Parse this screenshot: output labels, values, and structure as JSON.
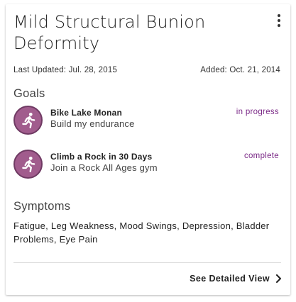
{
  "condition": {
    "title": "Mild Structural Bunion Deformity",
    "last_updated": "Last Updated: Jul. 28, 2015",
    "added": "Added: Oct. 21, 2014"
  },
  "goals": {
    "heading": "Goals",
    "items": [
      {
        "name": "Bike Lake Monan",
        "description": "Build my endurance",
        "status": "in progress",
        "icon": "running-person-icon"
      },
      {
        "name": "Climb a Rock in 30 Days",
        "description": "Join a Rock All Ages gym",
        "status": "complete",
        "icon": "running-person-icon"
      }
    ]
  },
  "symptoms": {
    "heading": "Symptoms",
    "text": "Fatigue, Leg Weakness, Mood Swings, Depression, Bladder Problems, Eye Pain"
  },
  "footer": {
    "detail_link_label": "See Detailed View"
  },
  "colors": {
    "accent_purple": "#7b2a87",
    "avatar_fill": "#a15c8d",
    "avatar_border": "#6f3a63"
  }
}
